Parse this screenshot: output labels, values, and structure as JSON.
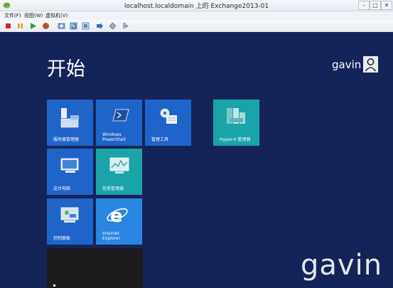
{
  "window": {
    "title": "localhost.localdomain 上的 Exchange2013-01",
    "controls": {
      "minimize": "–",
      "maximize": "□",
      "close": "✕"
    }
  },
  "menu": [
    "文件(F)",
    "视图(W)",
    "虚拟机(V)"
  ],
  "toolbar": {
    "icons": [
      "stop-icon",
      "pause-icon",
      "play-icon",
      "reset-icon",
      "snapshot-icon",
      "revert-icon",
      "manage-snapshots-icon",
      "send-ctrl-alt-del-icon",
      "network-icon",
      "usb-icon"
    ]
  },
  "start": {
    "title": "开始",
    "user": "gavin"
  },
  "tiles": [
    {
      "name": "tile-server-manager",
      "label": "服务器管理器",
      "color": "#1f64c8"
    },
    {
      "name": "tile-windows-powershell",
      "label": "Windows\nPowerShell",
      "color": "#1f64c8"
    },
    {
      "name": "tile-admin-tools",
      "label": "管理工具",
      "color": "#1f64c8"
    },
    {
      "name": "tile-hyperv-manager",
      "label": "Hyper-V 管理器",
      "color": "#1aa3a8"
    },
    {
      "name": "tile-this-pc",
      "label": "这台电脑",
      "color": "#1f64c8"
    },
    {
      "name": "tile-task-manager",
      "label": "任务管理器",
      "color": "#1aa3a8"
    },
    {
      "name": "tile-control-panel",
      "label": "控制面板",
      "color": "#1f64c8"
    },
    {
      "name": "tile-internet-explorer",
      "label": "Internet\nExplorer",
      "color": "#2a86e0"
    },
    {
      "name": "tile-desktop",
      "label": "",
      "color": "#1d1d1d"
    }
  ],
  "watermark": "gavin"
}
